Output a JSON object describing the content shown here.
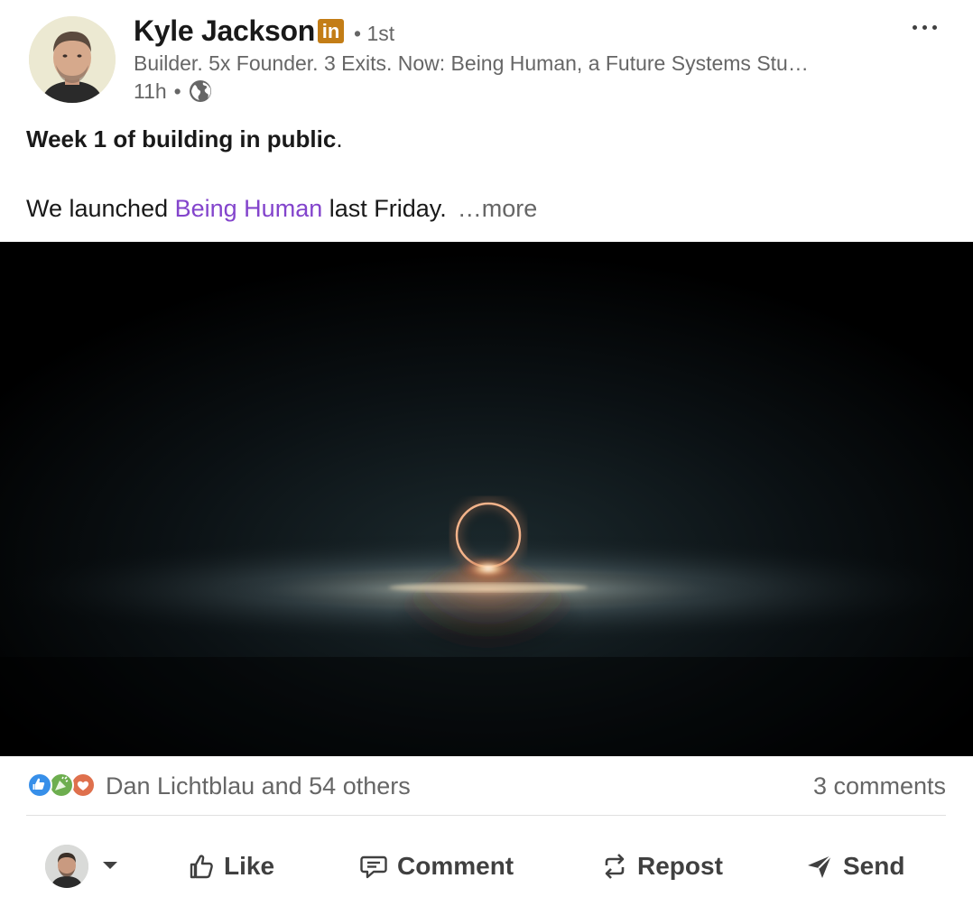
{
  "author": {
    "name": "Kyle Jackson",
    "badge": "in",
    "degree": "• 1st",
    "headline": "Builder. 5x Founder. 3 Exits. Now: Being Human, a Future Systems Stu…",
    "time": "11h",
    "visibility_icon": "globe-icon"
  },
  "post": {
    "title_bold": "Week 1 of building in public",
    "title_end": ".",
    "body_prefix": "We launched ",
    "link_text": "Being Human",
    "body_suffix": " last Friday.",
    "see_more": "…more"
  },
  "social": {
    "reactions_text": "Dan Lichtblau and 54 others",
    "comments_text": "3 comments",
    "reaction_icons": [
      "like-icon",
      "celebrate-icon",
      "love-icon"
    ]
  },
  "actions": {
    "like": "Like",
    "comment": "Comment",
    "repost": "Repost",
    "send": "Send"
  },
  "colors": {
    "link": "#8344cc",
    "badge": "#c37d16",
    "muted": "#666666"
  }
}
